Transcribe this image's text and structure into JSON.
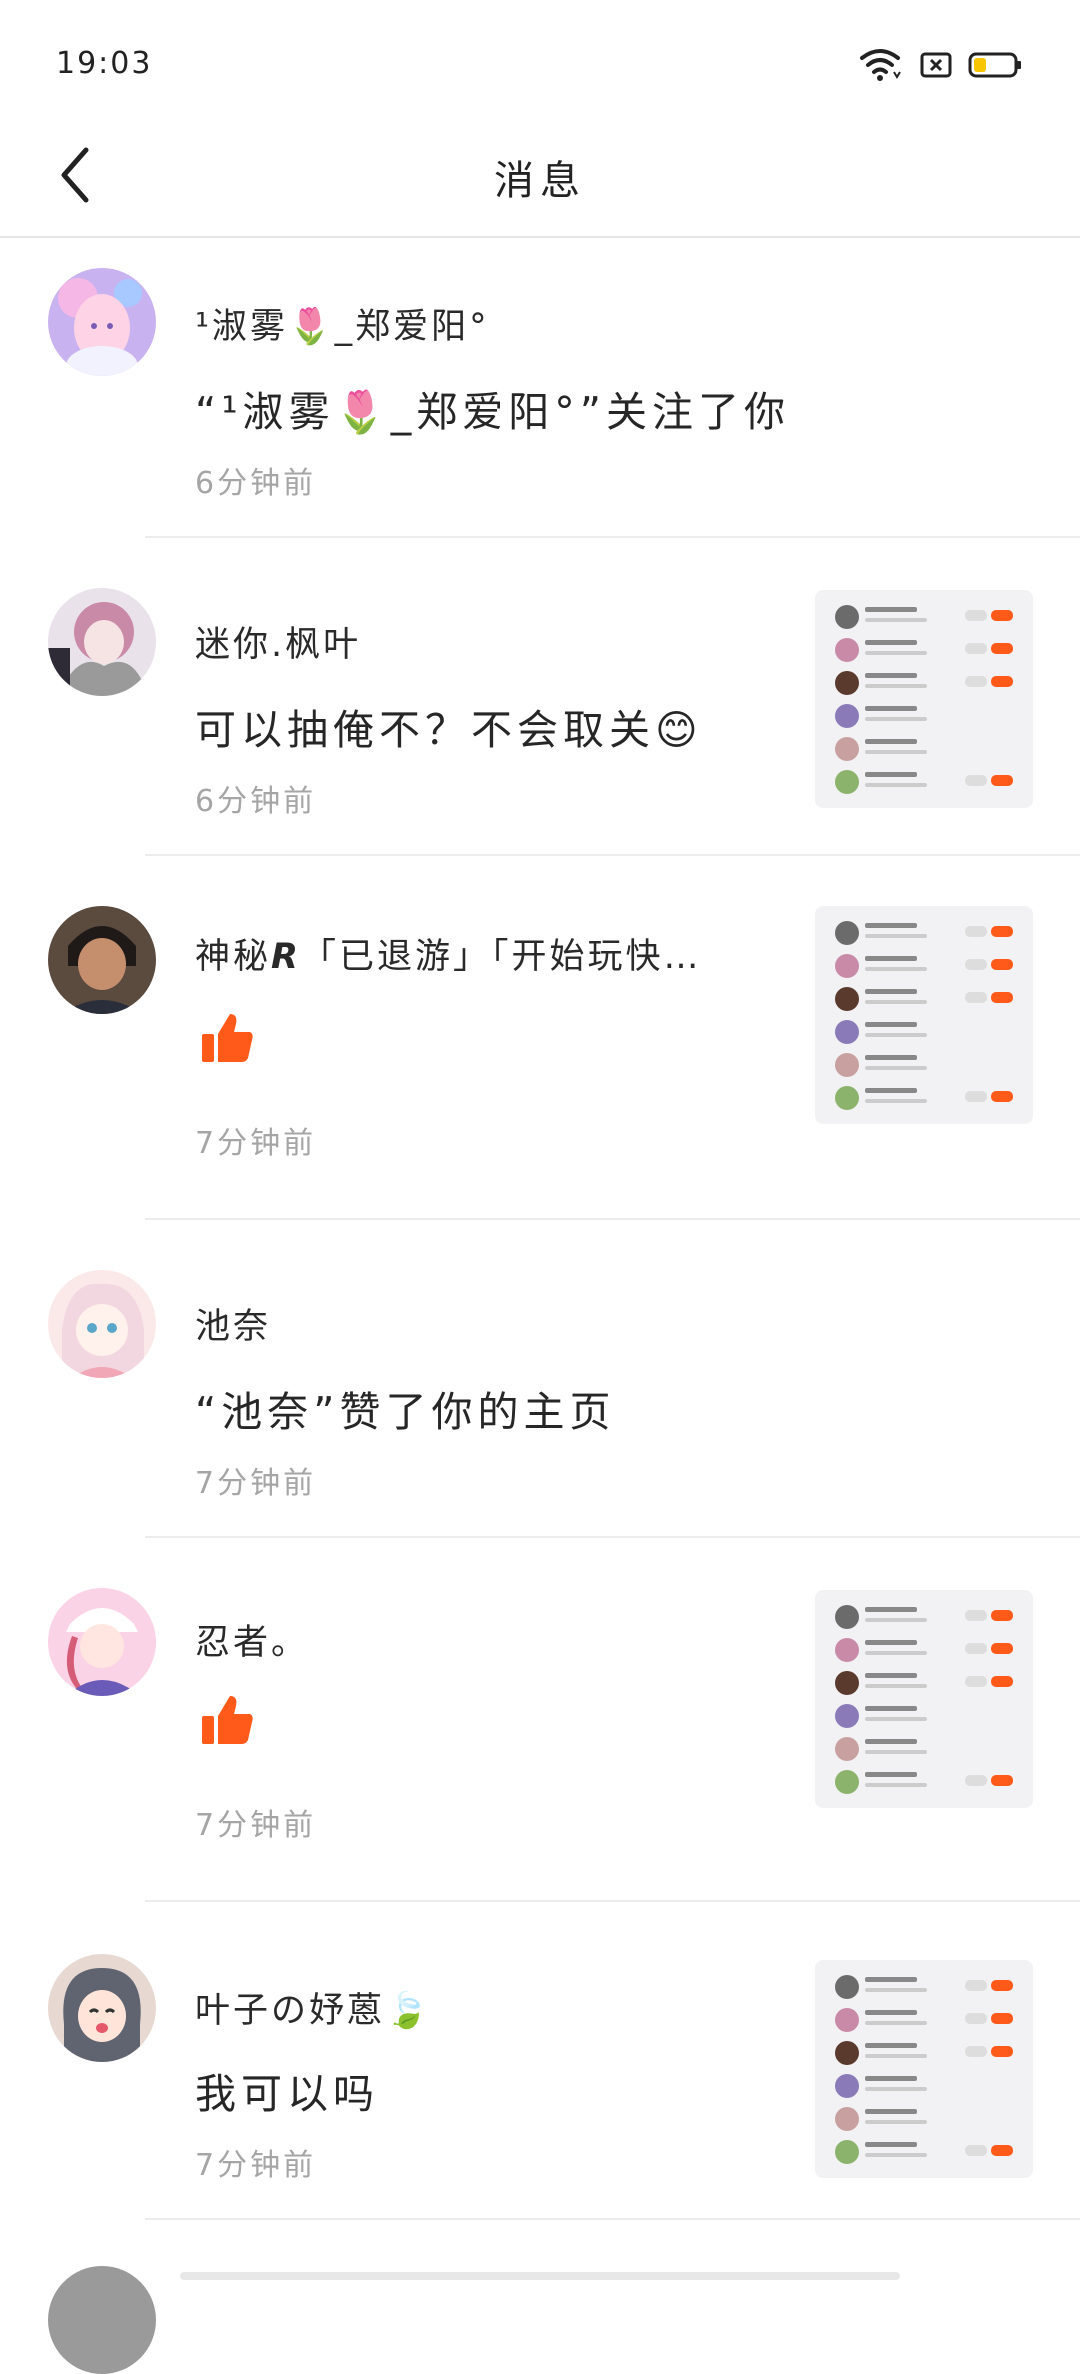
{
  "status_bar": {
    "time": "19:03",
    "icons": [
      "wifi-icon",
      "sim-off-icon",
      "battery-icon"
    ],
    "battery_color": "#f7c600"
  },
  "header": {
    "title": "消息",
    "back_icon": "chevron-left-icon"
  },
  "accent_color": "#ff5a1a",
  "messages": [
    {
      "name": "¹淑雾🌷_郑爱阳°",
      "text": "“¹淑雾🌷_郑爱阳°”关注了你",
      "time": "6分钟前",
      "type": "follow",
      "has_preview": false
    },
    {
      "name": "迷你.枫叶",
      "text": "可以抽俺不？不会取关😊",
      "time": "6分钟前",
      "type": "comment",
      "has_preview": true
    },
    {
      "name": "神秘𝙍「已退游」「开始玩快…",
      "text": "",
      "time": "7分钟前",
      "type": "like",
      "has_preview": true
    },
    {
      "name": "池奈",
      "text": "“池奈”赞了你的主页",
      "time": "7分钟前",
      "type": "like-profile",
      "has_preview": false
    },
    {
      "name": "忍者。",
      "text": "",
      "time": "7分钟前",
      "type": "like",
      "has_preview": true
    },
    {
      "name": "叶子の妤蒽🍃",
      "text": "我可以吗",
      "time": "7分钟前",
      "type": "comment",
      "has_preview": true
    }
  ]
}
